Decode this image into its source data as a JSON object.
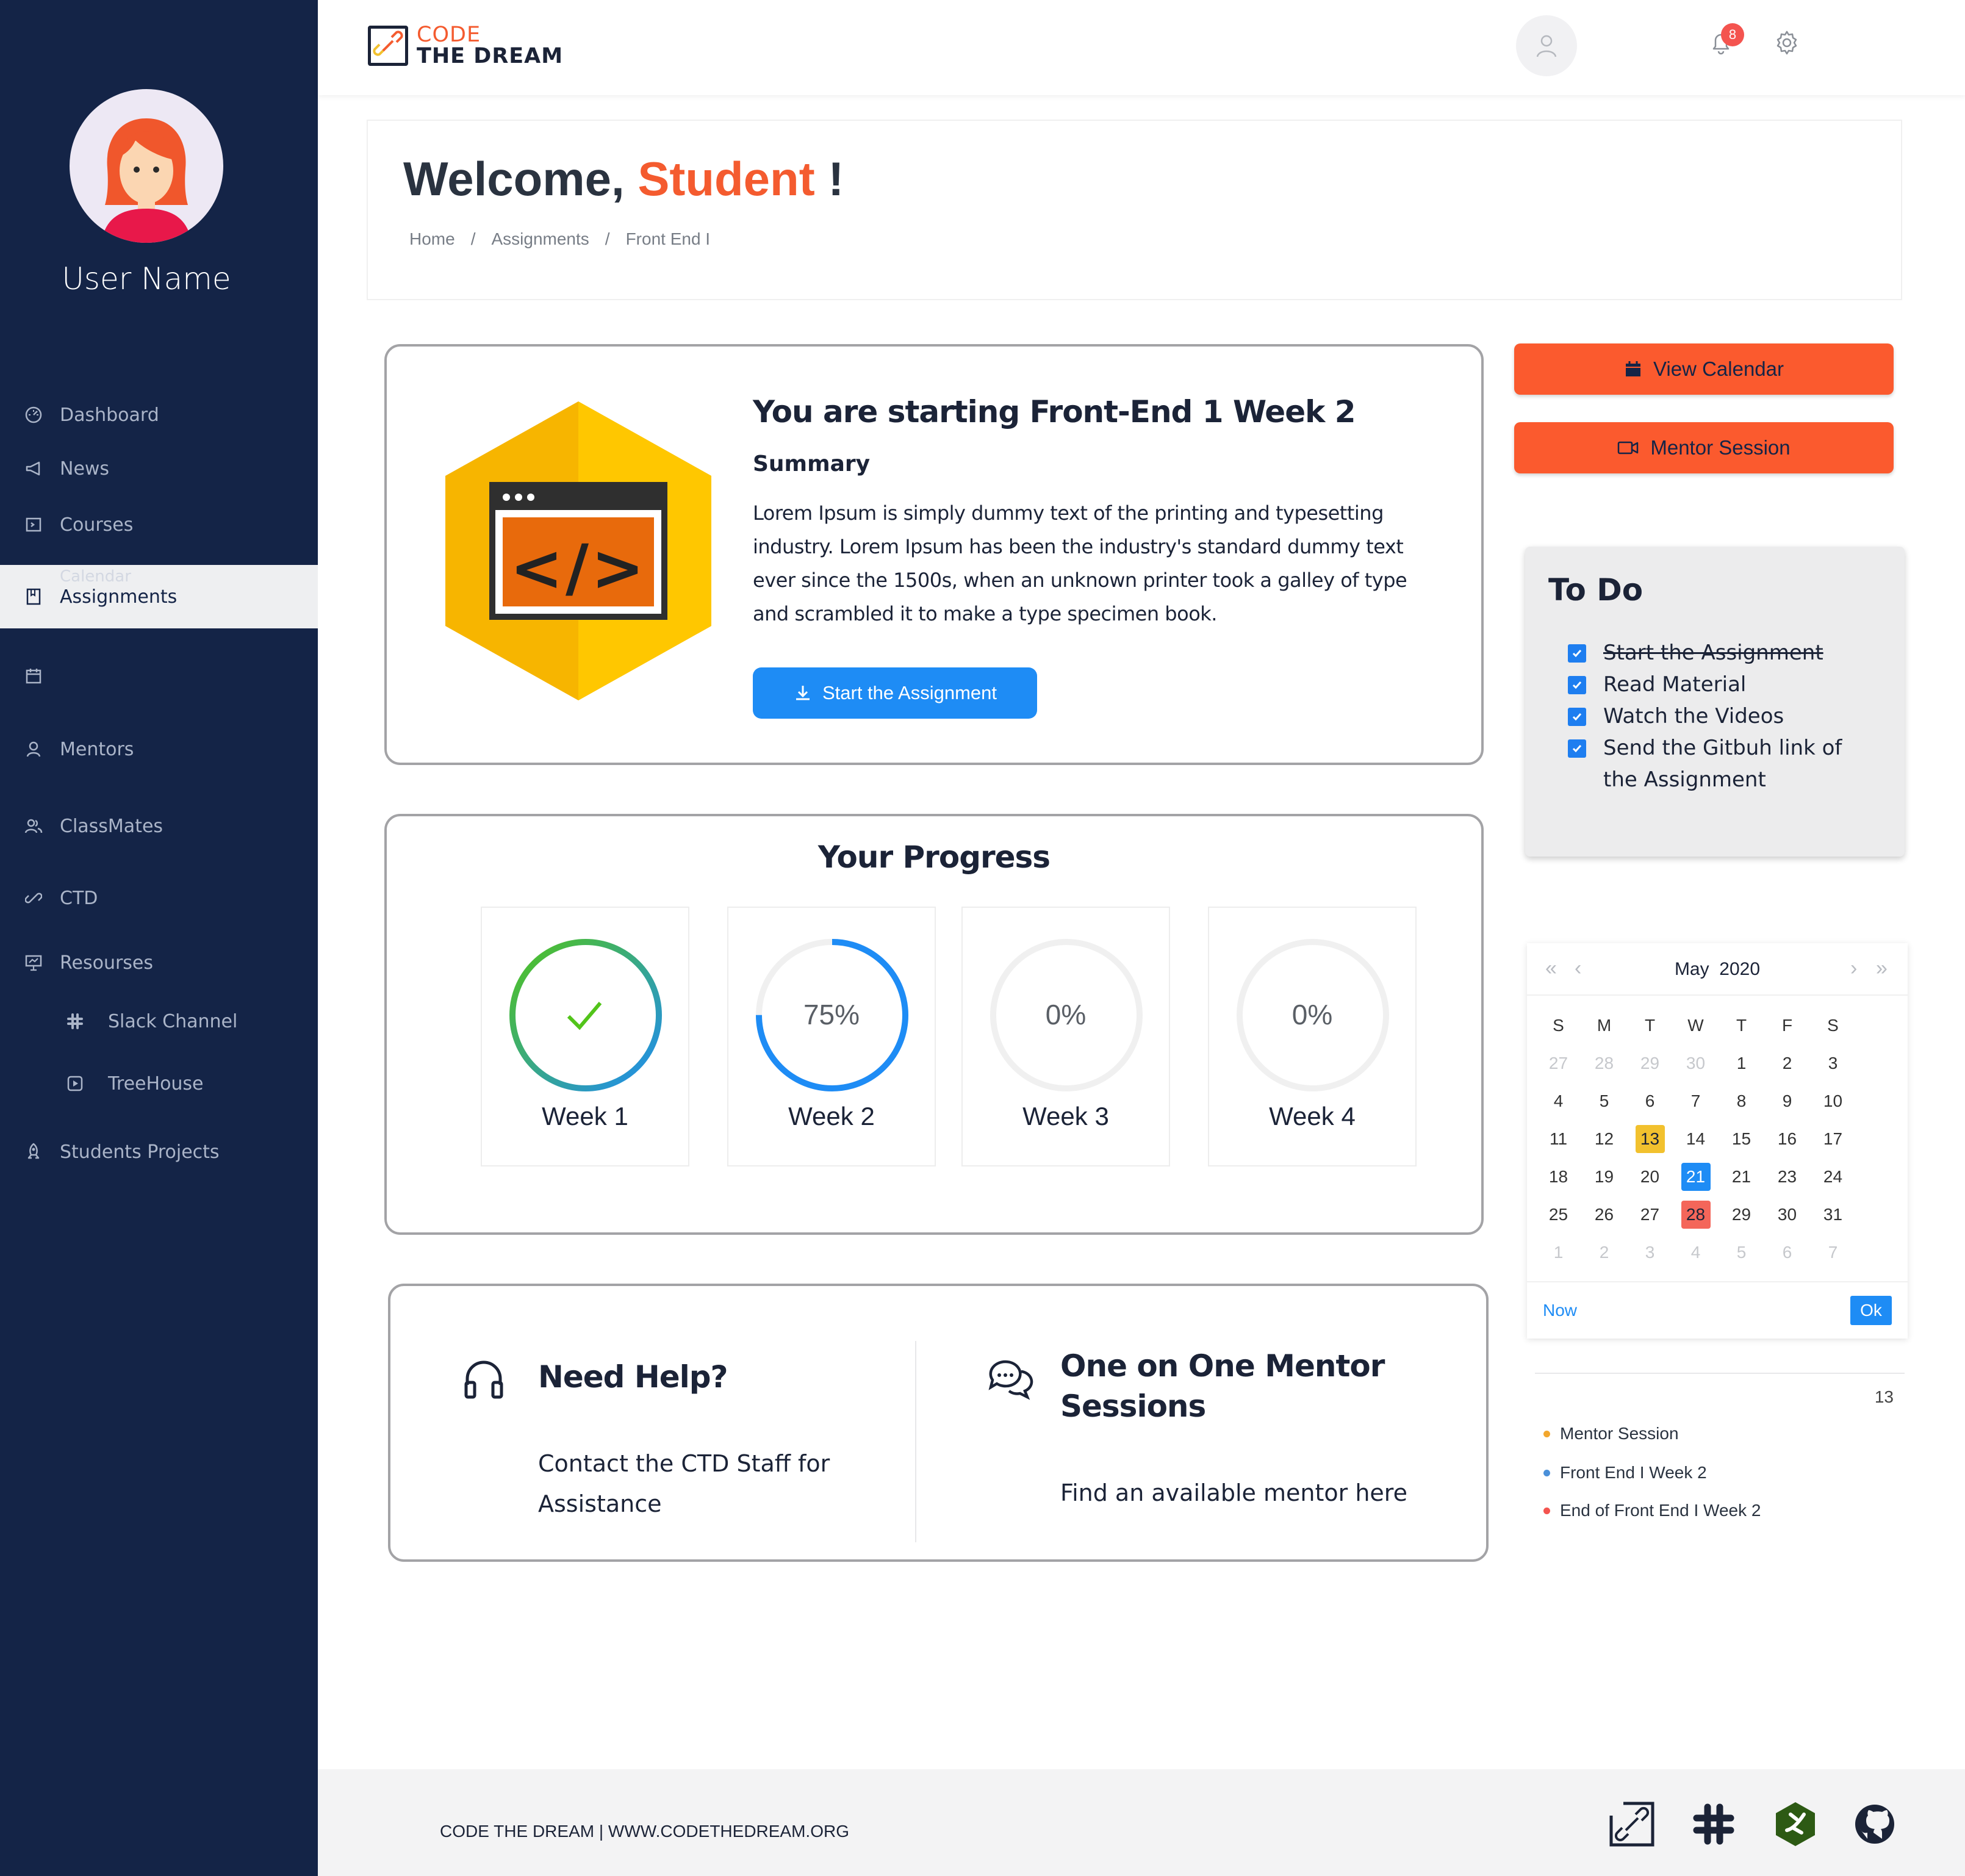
{
  "sidebar": {
    "user_name": "User Name",
    "items": [
      {
        "label": "Dashboard",
        "icon": "dashboard-icon"
      },
      {
        "label": "News",
        "icon": "megaphone-icon"
      },
      {
        "label": "Courses",
        "icon": "courses-icon"
      },
      {
        "label": "Assignments",
        "icon": "book-icon",
        "ghost_label": "Calendar"
      },
      {
        "label": "",
        "icon": "calendar-icon"
      },
      {
        "label": "Mentors",
        "icon": "user-icon"
      },
      {
        "label": "ClassMates",
        "icon": "users-icon"
      },
      {
        "label": "CTD",
        "icon": "link-icon"
      },
      {
        "label": "Resourses",
        "icon": "presentation-icon"
      },
      {
        "label": "Slack Channel",
        "icon": "slack-icon"
      },
      {
        "label": "TreeHouse",
        "icon": "play-icon"
      },
      {
        "label": "Students Projects",
        "icon": "rocket-icon"
      }
    ]
  },
  "header": {
    "logo_line1": "CODE",
    "logo_line2": "THE DREAM",
    "notification_count": "8",
    "icons": [
      "bell-icon",
      "gear-icon",
      "profile-icon"
    ]
  },
  "welcome": {
    "greeting": "Welcome,",
    "name": "Student",
    "exclaim": "!",
    "breadcrumb": [
      "Home",
      "Assignments",
      "Front End I"
    ],
    "breadcrumb_sep": "/"
  },
  "assignment": {
    "title": "You are starting Front-End 1 Week 2",
    "summary_label": "Summary",
    "summary_text": "Lorem Ipsum is simply dummy text of the printing and typesetting industry. Lorem Ipsum has been the industry's standard dummy text ever since the 1500s, when an unknown printer took a galley of type and scrambled it to make a type specimen book.",
    "button": "Start the Assignment",
    "code_glyph": "</>"
  },
  "progress": {
    "title": "Your Progress",
    "weeks": [
      {
        "label": "Week 1",
        "percent": 100,
        "display": "",
        "complete": true
      },
      {
        "label": "Week 2",
        "percent": 75,
        "display": "75%",
        "complete": false
      },
      {
        "label": "Week 3",
        "percent": 0,
        "display": "0%",
        "complete": false
      },
      {
        "label": "Week 4",
        "percent": 0,
        "display": "0%",
        "complete": false
      }
    ]
  },
  "help": {
    "help_title": "Need Help?",
    "help_text_1": "Contact the CTD Staff for",
    "help_text_2": "Assistance",
    "mentor_title_1": "One on One Mentor",
    "mentor_title_2": "Sessions",
    "mentor_text": "Find an available mentor here"
  },
  "actions": {
    "view_calendar": "View Calendar",
    "mentor_session": "Mentor Session"
  },
  "todo": {
    "title": "To Do",
    "items": [
      {
        "text": "Start the Assignment",
        "done": true,
        "struck": true
      },
      {
        "text": "Read Material",
        "done": true,
        "struck": false
      },
      {
        "text": "Watch the Videos",
        "done": true,
        "struck": false
      },
      {
        "text": "Send the Gitbuh link of",
        "text2": "the Assignment",
        "done": true,
        "struck": false
      }
    ]
  },
  "calendar": {
    "month": "May",
    "year": "2020",
    "weekdays": [
      "S",
      "M",
      "T",
      "W",
      "T",
      "F",
      "S"
    ],
    "weeks": [
      [
        "27",
        "28",
        "29",
        "30",
        "1",
        "2",
        "3"
      ],
      [
        "4",
        "5",
        "6",
        "7",
        "8",
        "9",
        "10"
      ],
      [
        "11",
        "12",
        "13",
        "14",
        "15",
        "16",
        "17"
      ],
      [
        "18",
        "19",
        "20",
        "21",
        "21",
        "23",
        "24"
      ],
      [
        "25",
        "26",
        "27",
        "28",
        "29",
        "30",
        "31"
      ],
      [
        "1",
        "2",
        "3",
        "4",
        "5",
        "6",
        "7"
      ]
    ],
    "highlight_yellow": "13",
    "highlight_blue": "21",
    "highlight_red": "28",
    "now_label": "Now",
    "ok_label": "Ok",
    "colors": {
      "yellow": "#f2c12e",
      "blue": "#1e8cf5",
      "red": "#f4665a"
    }
  },
  "events": {
    "day": "13",
    "items": [
      {
        "text": "Mentor Session",
        "color": "#f2a72e"
      },
      {
        "text": "Front End I Week 2",
        "color": "#4a90d9"
      },
      {
        "text": "End of Front End I Week 2",
        "color": "#f4544f"
      }
    ]
  },
  "footer": {
    "text": "CODE THE DREAM | WWW.CODETHEDREAM.ORG",
    "icons": [
      "ctd-link-icon",
      "slack-icon",
      "treehouse-icon",
      "github-icon"
    ]
  },
  "colors": {
    "sidebar_bg": "#142447",
    "accent_orange": "#f45b2f",
    "button_orange": "#fb5a2e",
    "accent_blue": "#1e8cf5"
  }
}
